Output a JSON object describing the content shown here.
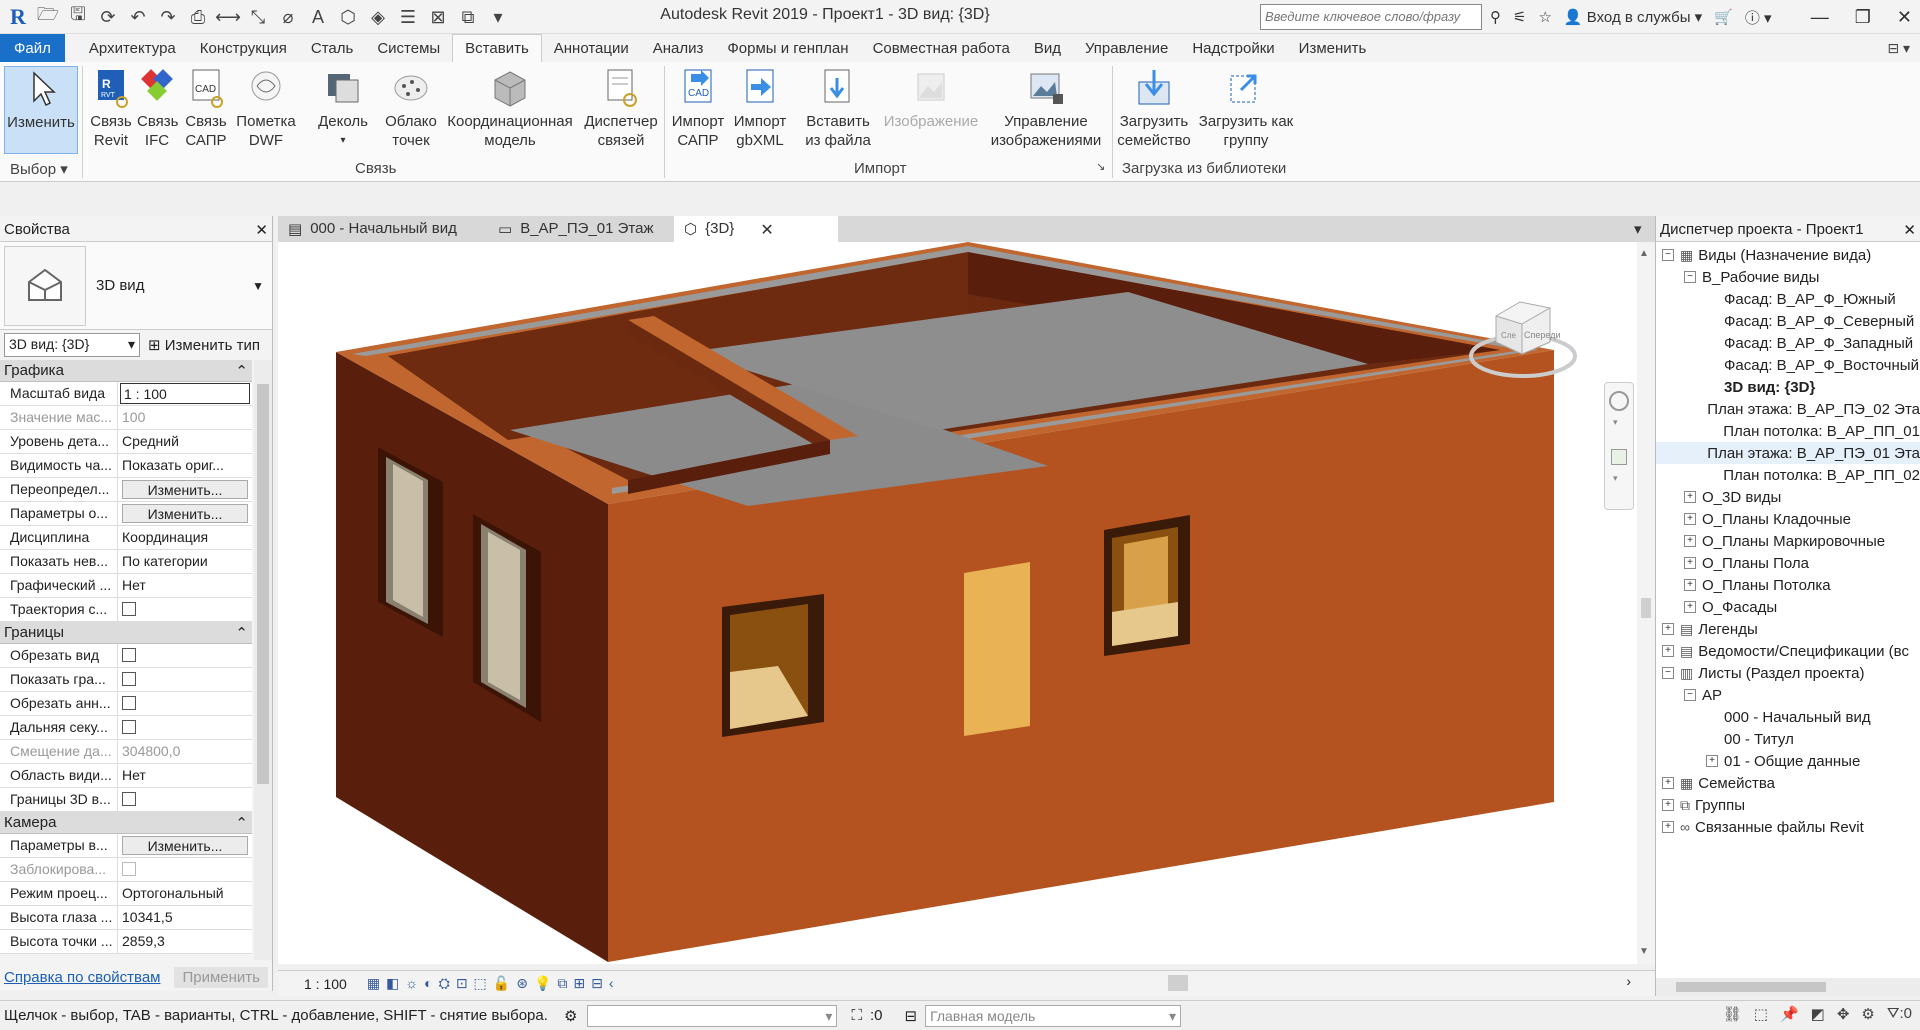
{
  "app": {
    "title": "Autodesk Revit 2019 - Проект1 - 3D вид: {3D}",
    "search_placeholder": "Введите ключевое слово/фразу",
    "signin": "Вход в службы",
    "logo": "R"
  },
  "ribbon_tabs": [
    "Файл",
    "Архитектура",
    "Конструкция",
    "Сталь",
    "Системы",
    "Вставить",
    "Аннотации",
    "Анализ",
    "Формы и генплан",
    "Совместная работа",
    "Вид",
    "Управление",
    "Надстройки",
    "Изменить"
  ],
  "ribbon": {
    "modify": "Изменить",
    "link_revit": "Связь Revit",
    "link_ifc": "Связь IFC",
    "link_cad": "Связь САПР",
    "markup_dwf": "Пометка DWF",
    "decal": "Деколь",
    "point_cloud": "Облако точек",
    "coordination_model": "Координационная модель",
    "manage_links": "Диспетчер связей",
    "import_cad": "Импорт САПР",
    "import_gbxml": "Импорт gbXML",
    "insert_from_file": "Вставить из файла",
    "image": "Изображение",
    "manage_images": "Управление изображениями",
    "load_family": "Загрузить семейство",
    "load_as_group": "Загрузить как группу",
    "panel_select": "Выбор",
    "panel_link": "Связь",
    "panel_import": "Импорт",
    "panel_load": "Загрузка из библиотеки"
  },
  "properties": {
    "title": "Свойства",
    "type_name": "3D вид",
    "instance": "3D вид: {3D}",
    "edit_type": "Изменить тип",
    "sections": {
      "graphics": "Графика",
      "extents": "Границы",
      "camera": "Камера"
    },
    "graphics_rows": [
      {
        "name": "Масштаб вида",
        "value": "1 : 100"
      },
      {
        "name": "Значение мас...",
        "value": "100"
      },
      {
        "name": "Уровень дета...",
        "value": "Средний"
      },
      {
        "name": "Видимость ча...",
        "value": "Показать ориг..."
      },
      {
        "name": "Переопредел...",
        "value": "Изменить..."
      },
      {
        "name": "Параметры о...",
        "value": "Изменить..."
      },
      {
        "name": "Дисциплина",
        "value": "Координация"
      },
      {
        "name": "Показать нев...",
        "value": "По категории"
      },
      {
        "name": "Графический ...",
        "value": "Нет"
      },
      {
        "name": "Траектория с...",
        "value": ""
      }
    ],
    "extents_rows": [
      {
        "name": "Обрезать вид",
        "value": ""
      },
      {
        "name": "Показать гра...",
        "value": ""
      },
      {
        "name": "Обрезать анн...",
        "value": ""
      },
      {
        "name": "Дальняя секу...",
        "value": ""
      },
      {
        "name": "Смещение да...",
        "value": "304800,0"
      },
      {
        "name": "Область види...",
        "value": "Нет"
      },
      {
        "name": "Границы 3D в...",
        "value": ""
      }
    ],
    "camera_rows": [
      {
        "name": "Параметры в...",
        "value": "Изменить..."
      },
      {
        "name": "Заблокирова...",
        "value": ""
      },
      {
        "name": "Режим проец...",
        "value": "Ортогональный"
      },
      {
        "name": "Высота глаза ...",
        "value": "10341,5"
      },
      {
        "name": "Высота точки ...",
        "value": "2859,3"
      }
    ],
    "help_link": "Справка по свойствам",
    "apply": "Применить"
  },
  "doc_tabs": [
    "000 - Начальный вид",
    "В_АР_ПЭ_01 Этаж",
    "{3D}"
  ],
  "view_footer": {
    "scale": "1 : 100"
  },
  "viewcube": {
    "left": "Сле",
    "front": "Спереди"
  },
  "project_browser": {
    "title": "Диспетчер проекта - Проект1",
    "nodes": [
      {
        "label": "Виды (Назначение вида)",
        "level": 0,
        "toggle": "−",
        "icon": "▦"
      },
      {
        "label": "В_Рабочие виды",
        "level": 1,
        "toggle": "−",
        "icon": ""
      },
      {
        "label": "Фасад: В_АР_Ф_Южный",
        "level": 2,
        "toggle": "",
        "icon": ""
      },
      {
        "label": "Фасад: В_АР_Ф_Северный",
        "level": 2,
        "toggle": "",
        "icon": ""
      },
      {
        "label": "Фасад: В_АР_Ф_Западный",
        "level": 2,
        "toggle": "",
        "icon": ""
      },
      {
        "label": "Фасад: В_АР_Ф_Восточный",
        "level": 2,
        "toggle": "",
        "icon": ""
      },
      {
        "label": "3D вид: {3D}",
        "level": 2,
        "toggle": "",
        "icon": "",
        "bold": true
      },
      {
        "label": "План этажа: В_АР_ПЭ_02 Эта",
        "level": 2,
        "toggle": "",
        "icon": ""
      },
      {
        "label": "План потолка: В_АР_ПП_01",
        "level": 2,
        "toggle": "",
        "icon": ""
      },
      {
        "label": "План этажа: В_АР_ПЭ_01 Эта",
        "level": 2,
        "toggle": "",
        "icon": "",
        "selected": true
      },
      {
        "label": "План потолка: В_АР_ПП_02",
        "level": 2,
        "toggle": "",
        "icon": ""
      },
      {
        "label": "О_3D виды",
        "level": 1,
        "toggle": "+",
        "icon": ""
      },
      {
        "label": "О_Планы Кладочные",
        "level": 1,
        "toggle": "+",
        "icon": ""
      },
      {
        "label": "О_Планы Маркировочные",
        "level": 1,
        "toggle": "+",
        "icon": ""
      },
      {
        "label": "О_Планы Пола",
        "level": 1,
        "toggle": "+",
        "icon": ""
      },
      {
        "label": "О_Планы Потолка",
        "level": 1,
        "toggle": "+",
        "icon": ""
      },
      {
        "label": "О_Фасады",
        "level": 1,
        "toggle": "+",
        "icon": ""
      },
      {
        "label": "Легенды",
        "level": 0,
        "toggle": "+",
        "icon": "▤"
      },
      {
        "label": "Ведомости/Спецификации (вс",
        "level": 0,
        "toggle": "+",
        "icon": "▤"
      },
      {
        "label": "Листы (Раздел проекта)",
        "level": 0,
        "toggle": "−",
        "icon": "▥"
      },
      {
        "label": "АР",
        "level": 1,
        "toggle": "−",
        "icon": ""
      },
      {
        "label": "000 - Начальный вид",
        "level": 2,
        "toggle": "",
        "icon": ""
      },
      {
        "label": "00 - Титул",
        "level": 2,
        "toggle": "",
        "icon": ""
      },
      {
        "label": "01 - Общие данные",
        "level": 2,
        "toggle": "+",
        "icon": ""
      },
      {
        "label": "Семейства",
        "level": 0,
        "toggle": "+",
        "icon": "▦"
      },
      {
        "label": "Группы",
        "level": 0,
        "toggle": "+",
        "icon": "⧉"
      },
      {
        "label": "Связанные файлы Revit",
        "level": 0,
        "toggle": "+",
        "icon": "∞"
      }
    ]
  },
  "status": {
    "hint": "Щелчок - выбор, TAB - варианты, CTRL - добавление, SHIFT - снятие выбора.",
    "selection_count": ":0",
    "main_model": "Главная модель",
    "filter_count": ":0"
  },
  "colors": {
    "accent": "#1a6fc9",
    "wall_outer": "#b4531f",
    "wall_side": "#5a1e0c",
    "wall_inner": "#6b2a10",
    "floor": "#8b8b8b",
    "window_light": "#e6b25a"
  }
}
